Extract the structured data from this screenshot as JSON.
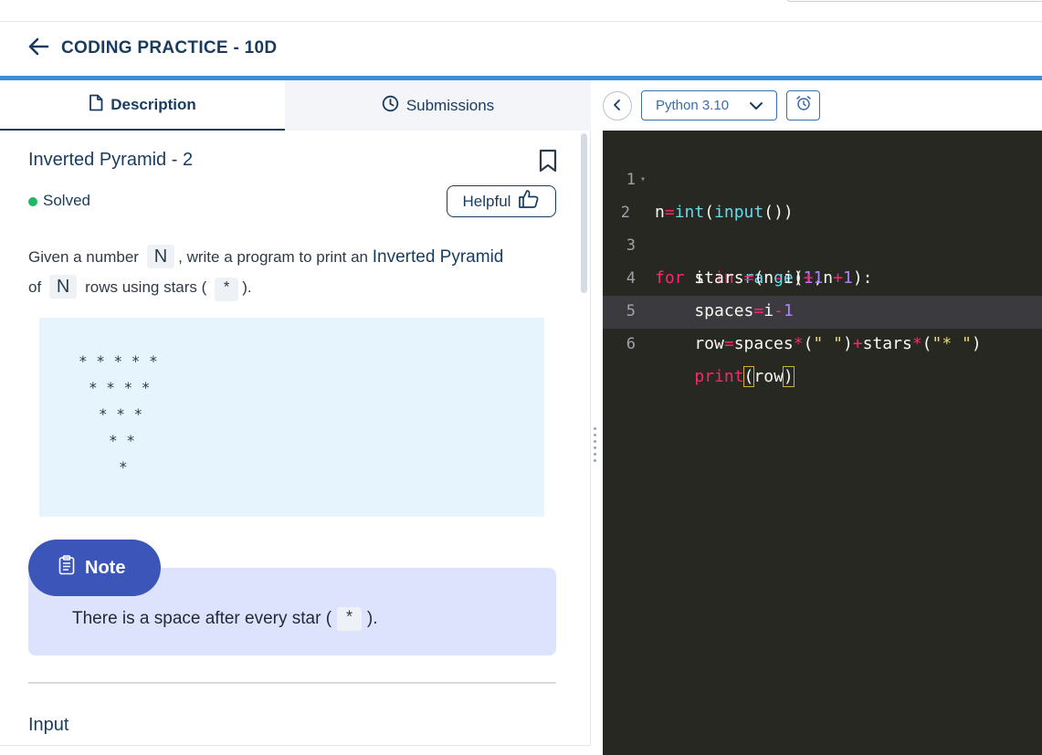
{
  "header": {
    "title": "CODING PRACTICE - 10D"
  },
  "tabs": [
    {
      "label": "Description",
      "icon": "document-icon",
      "active": true
    },
    {
      "label": "Submissions",
      "icon": "clock-icon",
      "active": false
    }
  ],
  "problem": {
    "title": "Inverted Pyramid - 2",
    "status": "Solved",
    "helpful_label": "Helpful",
    "desc_part1": "Given a number",
    "desc_var_n": "N",
    "desc_part2": ", write a program to print an",
    "desc_highlight": "Inverted Pyramid",
    "desc_part3": "of",
    "desc_var_n2": "N",
    "desc_part4": "rows using stars (",
    "desc_star": "*",
    "desc_part5": ").",
    "pyramid_lines": [
      "* * * * *",
      "* * * *",
      "* * *",
      "* *",
      "*"
    ],
    "note_label": "Note",
    "note_text_before": "There is a space after every star (",
    "note_star": "*",
    "note_text_after": ").",
    "input_heading": "Input"
  },
  "editor": {
    "language": "Python 3.10",
    "line_numbers": [
      "1",
      "2",
      "3",
      "4",
      "5",
      "6"
    ],
    "active_line": 6,
    "code_lines": [
      "n=int(input())",
      "for i in range(1,n+1):",
      "    stars=(n-i)+1",
      "    spaces=i-1",
      "    row=spaces*(\" \")+stars*(\"* \")",
      "    print(row)"
    ]
  },
  "colors": {
    "brand_navy": "#183b5e",
    "accent_blue": "#3d8ed6",
    "solved_green": "#1fb86a",
    "note_badge": "#3b56b8",
    "editor_bg": "#272822"
  }
}
